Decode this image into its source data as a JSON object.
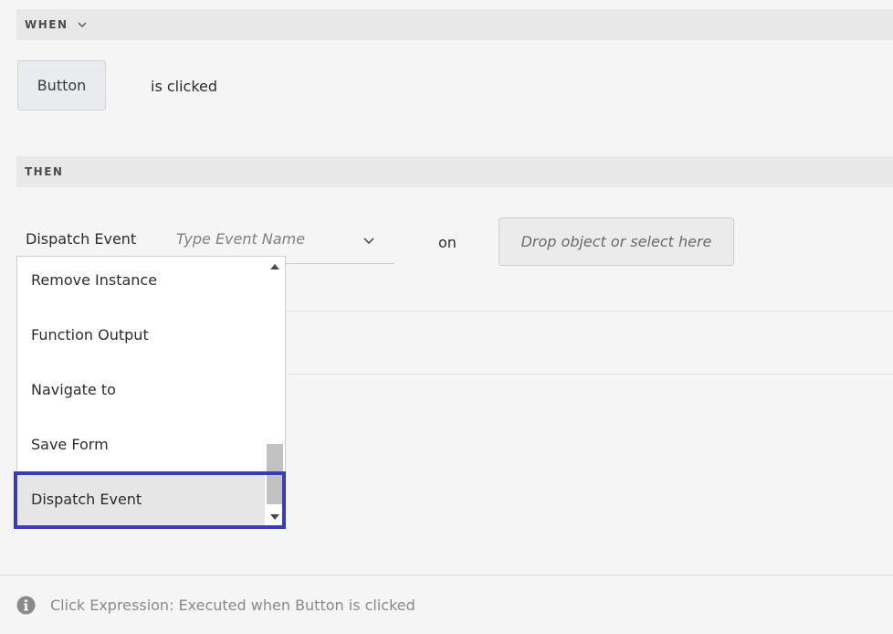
{
  "when": {
    "section_label": "WHEN",
    "trigger_component": "Button",
    "trigger_event": "is clicked"
  },
  "then": {
    "section_label": "THEN",
    "action_label": "Dispatch Event",
    "event_name_value": "",
    "event_name_placeholder": "Type Event Name",
    "on_label": "on",
    "drop_target_text": "Drop object or select here"
  },
  "action_dropdown": {
    "items": [
      "Remove Instance",
      "Function Output",
      "Navigate to",
      "Save Form",
      "Dispatch Event"
    ],
    "selected": "Dispatch Event"
  },
  "footer": {
    "summary": "Click Expression: Executed when Button is clicked",
    "icon": "info-icon"
  },
  "colors": {
    "selection_outline": "#3b3bb8",
    "section_bar": "#e8e8e8",
    "background": "#f5f5f5"
  }
}
